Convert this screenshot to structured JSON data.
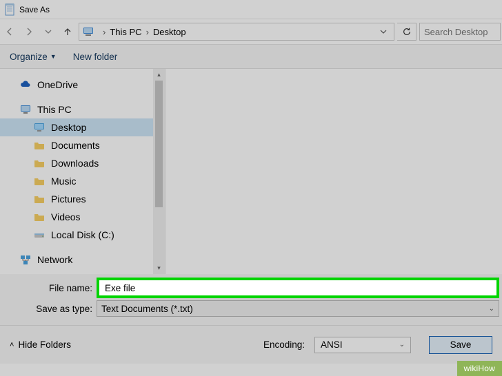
{
  "window": {
    "title": "Save As"
  },
  "nav": {
    "address": {
      "root": "This PC",
      "current": "Desktop"
    },
    "search_placeholder": "Search Desktop"
  },
  "toolbar": {
    "organize": "Organize",
    "new_folder": "New folder"
  },
  "tree": {
    "onedrive": "OneDrive",
    "thispc": "This PC",
    "desktop": "Desktop",
    "documents": "Documents",
    "downloads": "Downloads",
    "music": "Music",
    "pictures": "Pictures",
    "videos": "Videos",
    "localdisk": "Local Disk (C:)",
    "network": "Network"
  },
  "fields": {
    "file_name_label": "File name:",
    "file_name_value": "Exe file",
    "save_type_label": "Save as type:",
    "save_type_value": "Text Documents (*.txt)"
  },
  "footer": {
    "hide_folders": "Hide Folders",
    "encoding_label": "Encoding:",
    "encoding_value": "ANSI",
    "save": "Save"
  },
  "watermark": "wikiHow"
}
